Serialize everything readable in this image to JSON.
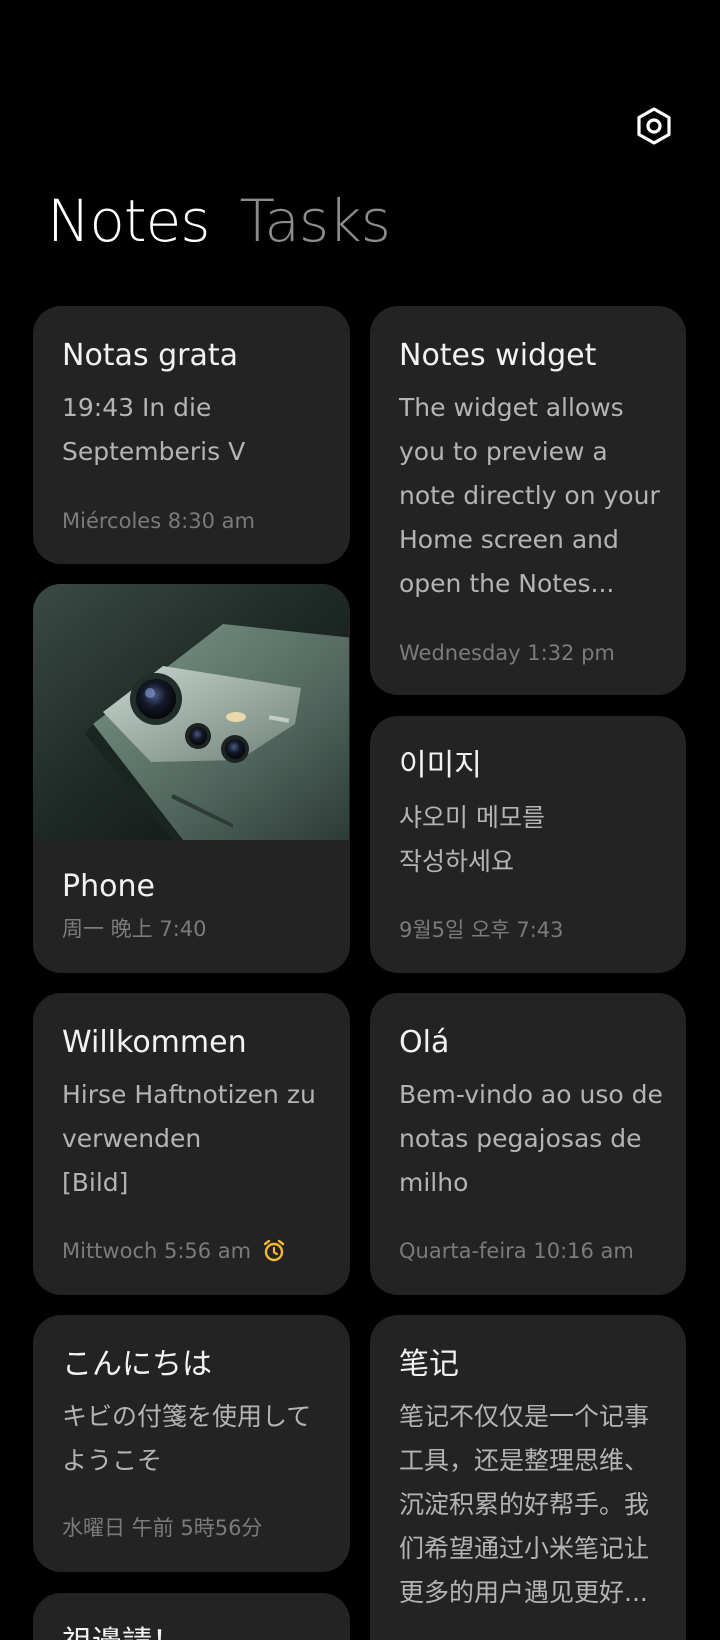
{
  "header": {
    "settings_icon": "gear-icon",
    "tabs": [
      {
        "label": "Notes",
        "active": true
      },
      {
        "label": "Tasks",
        "active": false
      }
    ]
  },
  "notes_left": [
    {
      "title": "Notas grata",
      "body": "19:43 In die\nSeptemberis V",
      "date": "Miércoles 8:30 am"
    },
    {
      "title": "Phone",
      "date": "周一 晚上 7:40",
      "image": "phone-camera-photo"
    },
    {
      "title": "Willkommen",
      "body": "Hirse Haftnotizen zu\nverwenden\n[Bild]",
      "date": "Mittwoch 5:56 am",
      "reminder_icon": "alarm-clock-icon"
    },
    {
      "title": "こんにちは",
      "body": "キビの付箋を使用して\nようこそ",
      "date": "水曜日 午前 5時56分"
    },
    {
      "title": "祖邊請！"
    }
  ],
  "notes_right": [
    {
      "title": "Notes widget",
      "body": "The widget allows\nyou to preview a\nnote directly on your\nHome screen and\nopen the Notes...",
      "date": "Wednesday 1:32 pm"
    },
    {
      "title": "이미지",
      "body": "샤오미 메모를\n작성하세요",
      "date": "9월5일 오후 7:43"
    },
    {
      "title": "Olá",
      "body": "Bem-vindo ao uso de\nnotas pegajosas de\nmilho",
      "date": "Quarta-feira 10:16 am"
    },
    {
      "title": "笔记",
      "body": "笔记不仅仅是一个记事\n工具，还是整理思维、\n沉淀积累的好帮手。我\n们希望通过小米笔记让\n更多的用户遇见更好..."
    }
  ],
  "colors": {
    "background": "#000000",
    "card": "#232323",
    "alarm_accent": "#f5b82e"
  }
}
